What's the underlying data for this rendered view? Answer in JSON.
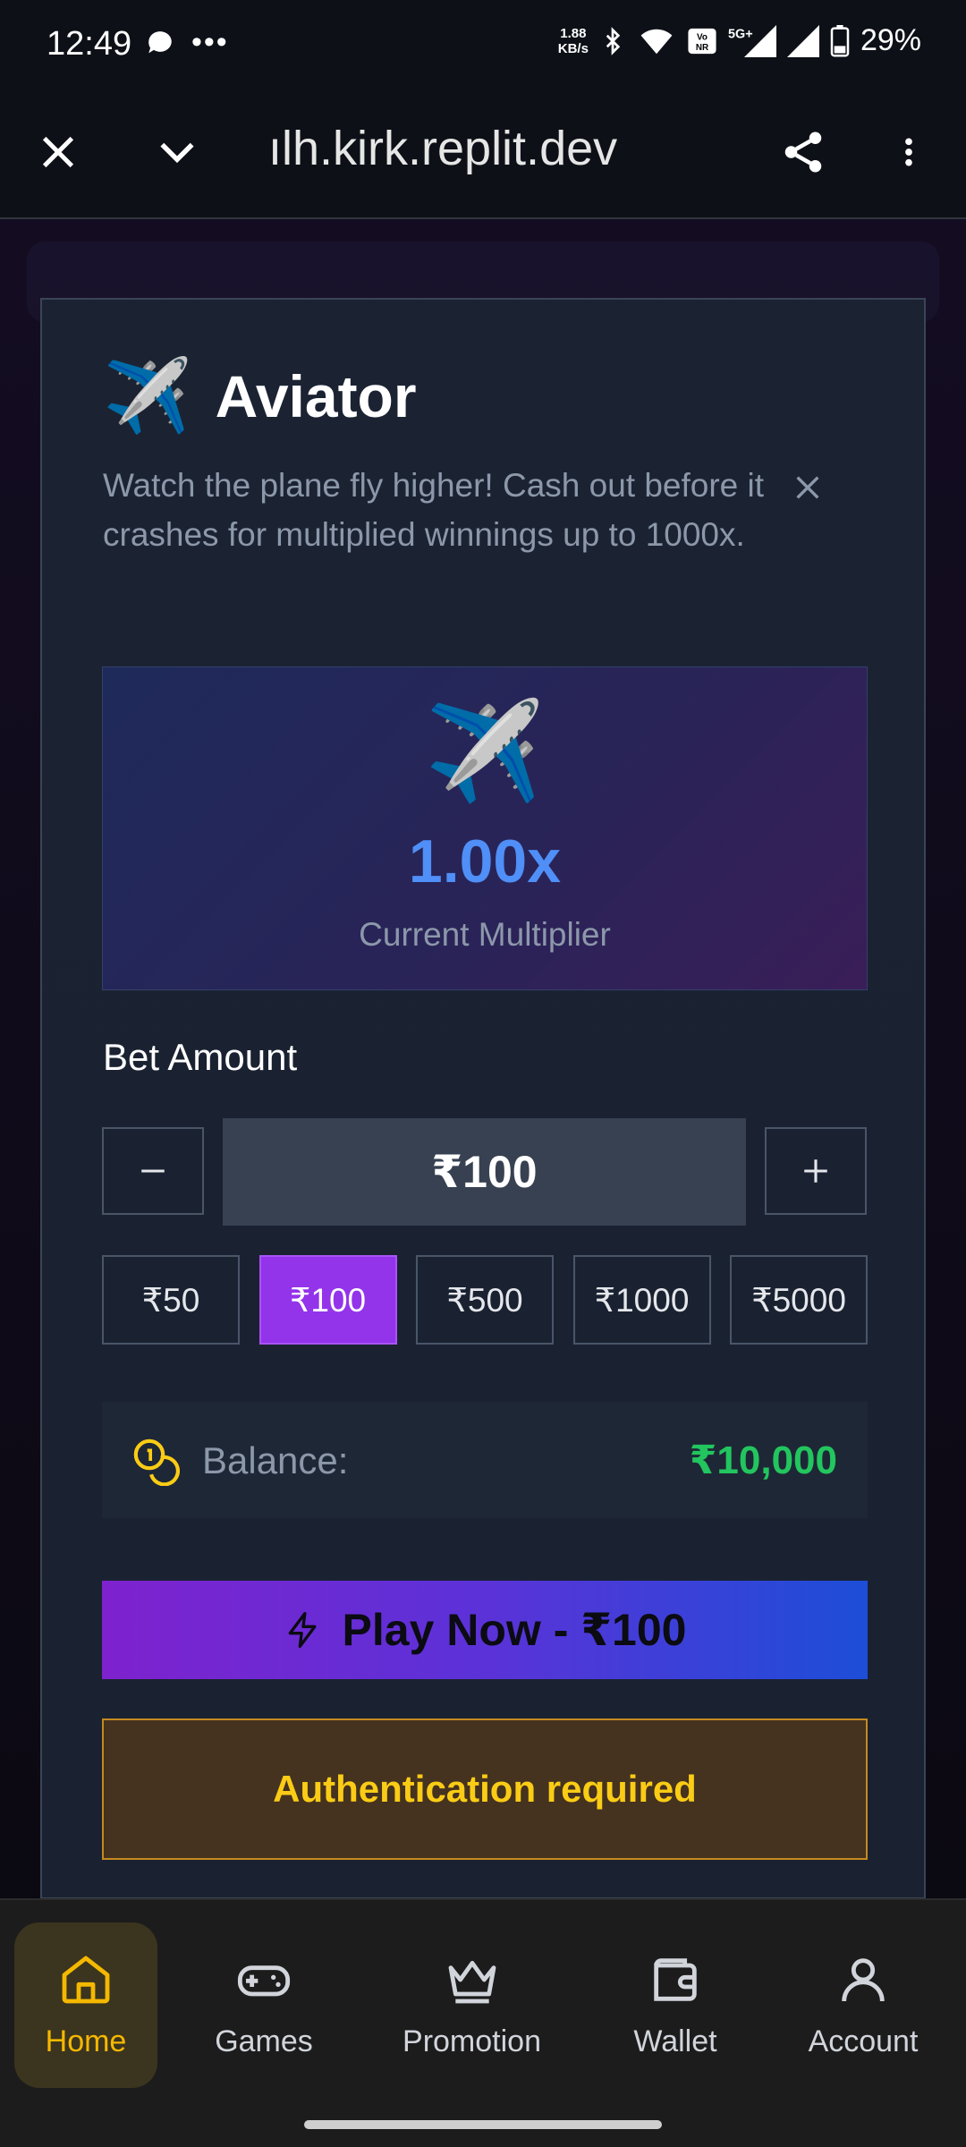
{
  "status_bar": {
    "time": "12:49",
    "speed_line1": "1.88",
    "speed_line2": "KB/s",
    "battery": "29%"
  },
  "browser": {
    "url": "ılh.kirk.replit.dev"
  },
  "modal": {
    "emoji": "✈️",
    "title": "Aviator",
    "description": "Watch the plane fly higher! Cash out before it crashes for multiplied winnings up to 1000x.",
    "hero": {
      "emoji": "✈️",
      "multiplier": "1.00x",
      "label": "Current Multiplier"
    },
    "bet_label": "Bet Amount",
    "amount": "₹100",
    "chips": [
      "₹50",
      "₹100",
      "₹500",
      "₹1000",
      "₹5000"
    ],
    "selected_chip": "₹100",
    "balance_label": "Balance:",
    "balance_value": "₹10,000",
    "play_label": "Play Now - ₹100",
    "auth_label": "Authentication required"
  },
  "nav": {
    "items": [
      {
        "label": "Home",
        "icon": "home-icon"
      },
      {
        "label": "Games",
        "icon": "gamepad-icon"
      },
      {
        "label": "Promotion",
        "icon": "crown-icon"
      },
      {
        "label": "Wallet",
        "icon": "wallet-icon"
      },
      {
        "label": "Account",
        "icon": "user-icon"
      }
    ],
    "active": "Home"
  },
  "colors": {
    "accent_purple": "#9333ea",
    "balance_green": "#22c55e",
    "warning_yellow": "#facc15",
    "multiplier_blue": "#4f8ff7"
  }
}
